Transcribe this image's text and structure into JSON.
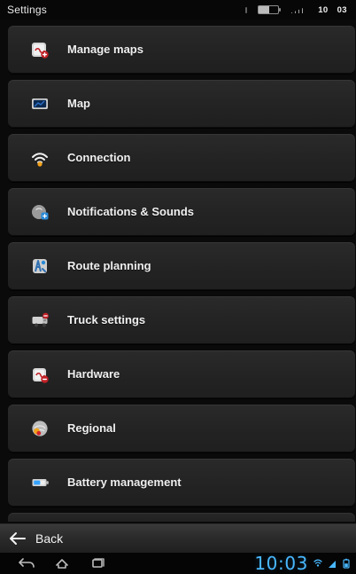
{
  "topbar": {
    "title": "Settings",
    "time_left": "10",
    "time_right": "03"
  },
  "menu": {
    "items": [
      {
        "label": "Manage maps",
        "icon": "manage-maps-icon"
      },
      {
        "label": "Map",
        "icon": "map-screen-icon"
      },
      {
        "label": "Connection",
        "icon": "connection-wifi-icon"
      },
      {
        "label": "Notifications & Sounds",
        "icon": "notifications-sounds-icon"
      },
      {
        "label": "Route planning",
        "icon": "route-planning-icon"
      },
      {
        "label": "Truck settings",
        "icon": "truck-settings-icon"
      },
      {
        "label": "Hardware",
        "icon": "hardware-icon"
      },
      {
        "label": "Regional",
        "icon": "regional-icon"
      },
      {
        "label": "Battery management",
        "icon": "battery-management-icon"
      }
    ]
  },
  "backbar": {
    "label": "Back"
  },
  "navbar": {
    "clock": "10:03"
  },
  "colors": {
    "accent_blue": "#48b8ff",
    "orange": "#f2a21a",
    "red": "#d3232a"
  }
}
